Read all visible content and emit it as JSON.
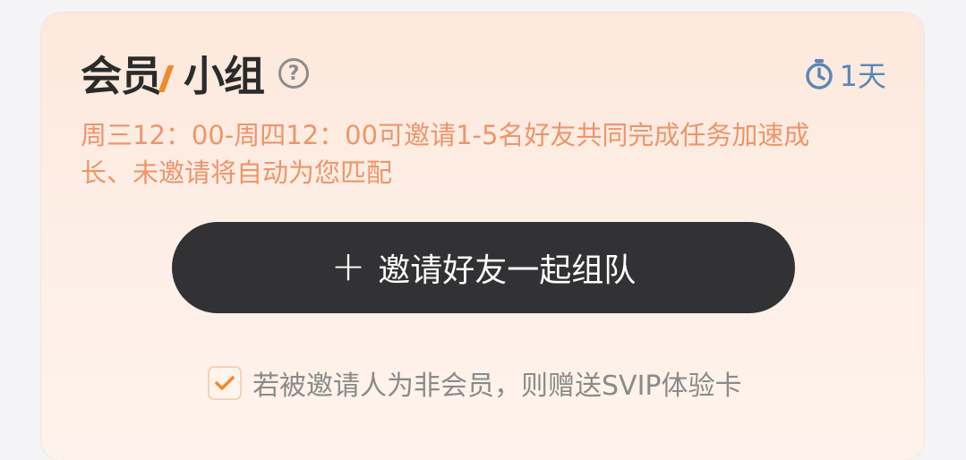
{
  "group": {
    "title_part1": "会员",
    "title_part2": "小组",
    "timer_text": "1天",
    "description": "周三12：00-周四12：00可邀请1-5名好友共同完成任务加速成长、未邀请将自动为您匹配",
    "invite_button": "邀请好友一起组队",
    "plus_icon": "+",
    "help_icon": "?",
    "agreement_checked": true,
    "agreement_text": "若被邀请人为非会员，则赠送SVIP体验卡"
  },
  "colors": {
    "accent": "#f08a2a",
    "desc": "#ef956a",
    "timer": "#5a86b8",
    "button_bg": "#323234"
  },
  "icons": {
    "help": "question-circle-icon",
    "timer": "stopwatch-icon",
    "plus": "plus-icon",
    "check": "checkmark-icon"
  }
}
